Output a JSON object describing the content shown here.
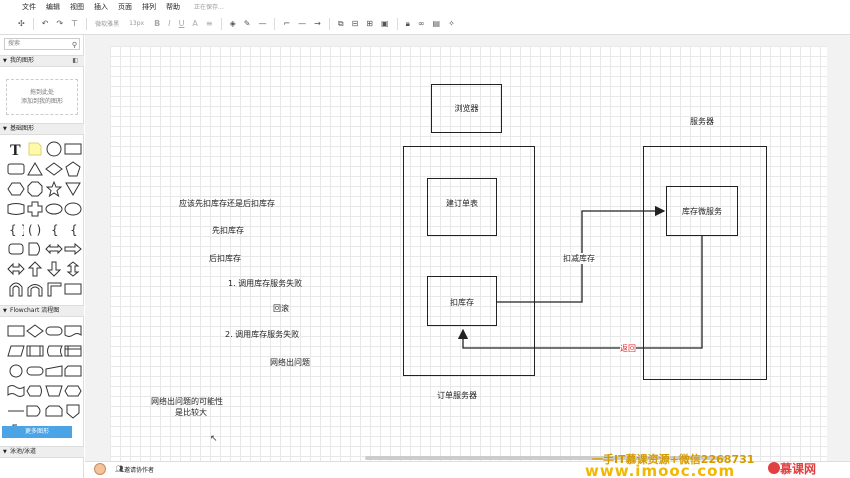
{
  "menu": {
    "items": [
      "文件",
      "编辑",
      "视图",
      "插入",
      "页面",
      "排列",
      "帮助"
    ],
    "status": "正在保存..."
  },
  "toolbar": {
    "font_family": "微软雅黑",
    "font_size": "13px"
  },
  "sidebar": {
    "search_placeholder": "搜索",
    "my_shapes": "我的图形",
    "drop_hint_1": "拖到此处",
    "drop_hint_2": "添加到我的图形",
    "basic_shapes": "基础图形",
    "flowchart": "Flowchart 流程图",
    "swimlane": "泳池/泳道",
    "more_shapes": "更多图形"
  },
  "bottom": {
    "invite": "邀请协作者"
  },
  "diagram": {
    "question": "应该先扣库存还是后扣库存",
    "first": "先扣库存",
    "later": "后扣库存",
    "fail1": "1. 调用库存服务失败",
    "rollback": "回滚",
    "fail2": "2. 调用库存服务失败",
    "network": "网络出问题",
    "note_1": "网络出问题的可能性",
    "note_2": "是比较大",
    "browser": "浏览器",
    "server": "服务器",
    "create_order": "建订单表",
    "deduct": "扣库存",
    "order_server": "订单服务器",
    "inventory_service": "库存微服务",
    "deduct_stock": "扣减库存",
    "return": "返回"
  },
  "watermark": {
    "line1": "一手IT慕课资源+微信2268731",
    "line2": "www.imooc.com",
    "brand": "慕课网"
  },
  "colors": {
    "accent": "#4aa4e6",
    "return_red": "#e02020",
    "watermark": "#f0b800"
  }
}
